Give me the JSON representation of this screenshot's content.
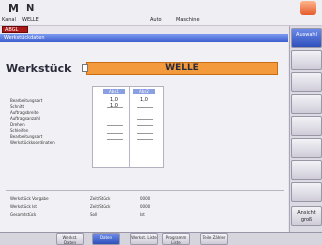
{
  "header": {
    "logo_a": "M",
    "logo_b": "N",
    "channel_label": "Kanal",
    "channel_value": "WELLE",
    "mode_label": "Auto",
    "mode_value": "Maschine",
    "program_name": "ABGL"
  },
  "panel": {
    "title_bar": "Werkstückdaten",
    "label": "Werkstück",
    "value": "WELLE"
  },
  "table": {
    "columns": [
      "Abs1",
      "Abs2"
    ],
    "rows": [
      {
        "label": "Bearbeitungsart",
        "values": [
          "1,0",
          "1,0"
        ]
      },
      {
        "label": "Schnitt",
        "values": [
          "",
          ""
        ]
      },
      {
        "label": "Auftragsbreite",
        "values": [
          "1,0",
          ""
        ]
      },
      {
        "label": "Auftragsanzahl",
        "values": [
          "",
          ""
        ]
      },
      {
        "label": "Drehen",
        "values": [
          "",
          ""
        ]
      },
      {
        "label": "Schleifen",
        "values": [
          "",
          ""
        ]
      },
      {
        "label": "Bearbeitungsart",
        "values": [
          "",
          ""
        ]
      },
      {
        "label": "Werkstückkoordinaten",
        "values": [
          "",
          ""
        ]
      }
    ]
  },
  "bottom_info": [
    {
      "label": "Werkstück Vorgabe",
      "v1": "Zeit/Stück",
      "v2": "0000"
    },
    {
      "label": "Werkstück Ist",
      "v1": "Zeit/Stück",
      "v2": "0000"
    },
    {
      "label": "Gesamtstück",
      "v1": "Soll",
      "v2": "Ist"
    }
  ],
  "sidebar": {
    "items": [
      {
        "label": "Auswahl",
        "active": true
      },
      {
        "label": ""
      },
      {
        "label": ""
      },
      {
        "label": ""
      },
      {
        "label": ""
      },
      {
        "label": ""
      },
      {
        "label": ""
      },
      {
        "label": ""
      },
      {
        "label": "Ansicht groß"
      }
    ]
  },
  "softkeys": [
    {
      "label": "Werkst. Daten"
    },
    {
      "label": "Daten",
      "active": true
    },
    {
      "label": "Werkst. Liste"
    },
    {
      "label": "Programm Liste"
    },
    {
      "label": "Teile Zähler"
    }
  ],
  "colors": {
    "accent_blue": "#3e5ecf",
    "orange": "#f39b3c",
    "alarm_red": "#a91919"
  }
}
